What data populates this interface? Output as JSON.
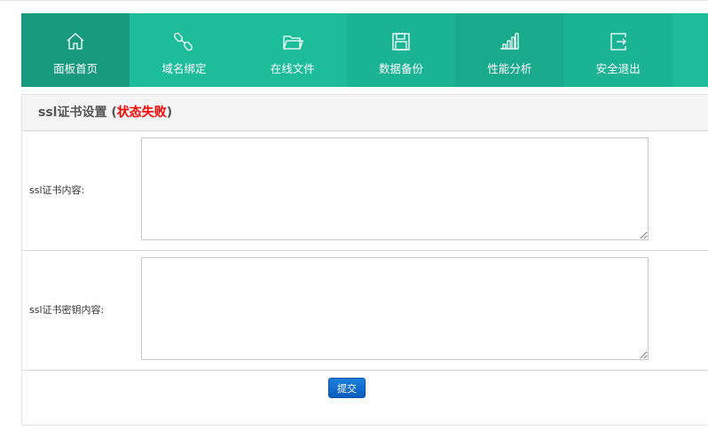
{
  "nav": [
    {
      "label": "面板首页",
      "icon": "home-icon"
    },
    {
      "label": "域名绑定",
      "icon": "link-icon"
    },
    {
      "label": "在线文件",
      "icon": "folder-icon"
    },
    {
      "label": "数据备份",
      "icon": "save-icon"
    },
    {
      "label": "性能分析",
      "icon": "signal-bars-icon"
    },
    {
      "label": "安全退出",
      "icon": "logout-icon"
    }
  ],
  "panel": {
    "title": "ssl证书设置",
    "status_open": " (",
    "status": "状态失败",
    "status_close": ")",
    "cert_label": "ssl证书内容:",
    "cert_value": "",
    "key_label": "ssl证书密钥内容:",
    "key_value": "",
    "submit": "提交"
  },
  "colors": {
    "nav_bg": "#1dbd9a",
    "nav_active": "#179a7d",
    "status": "#ff0000",
    "button": "#0a5cc0"
  }
}
